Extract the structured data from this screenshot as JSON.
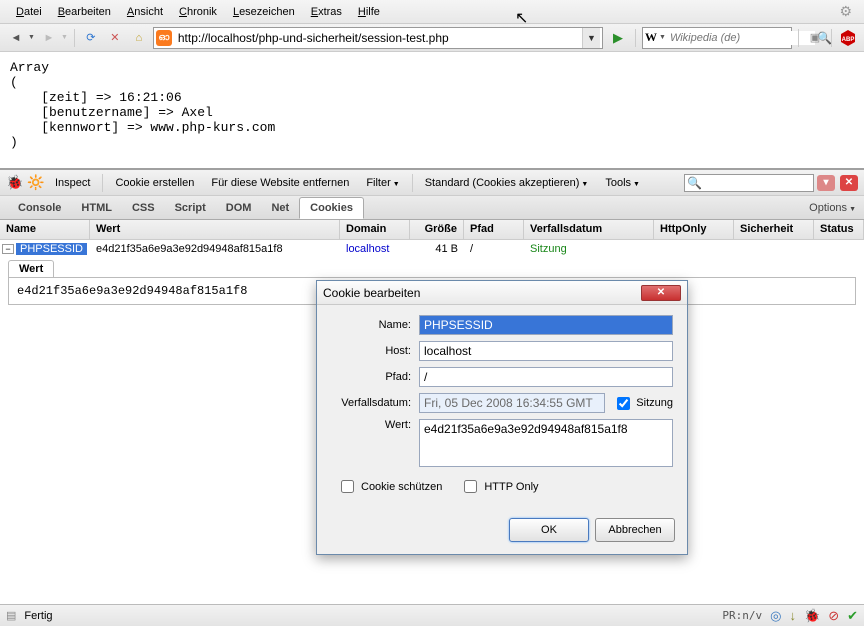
{
  "menubar": {
    "items": [
      {
        "label": "Datei",
        "accel": "D"
      },
      {
        "label": "Bearbeiten",
        "accel": "B"
      },
      {
        "label": "Ansicht",
        "accel": "A"
      },
      {
        "label": "Chronik",
        "accel": "C"
      },
      {
        "label": "Lesezeichen",
        "accel": "L"
      },
      {
        "label": "Extras",
        "accel": "E"
      },
      {
        "label": "Hilfe",
        "accel": "H"
      }
    ]
  },
  "toolbar": {
    "url": "http://localhost/php-und-sicherheit/session-test.php",
    "wiki_placeholder": "Wikipedia (de)",
    "wiki_prefix": "W"
  },
  "page": {
    "text": "Array\n(\n    [zeit] => 16:21:06\n    [benutzername] => Axel\n    [kennwort] => www.php-kurs.com\n)"
  },
  "firebug": {
    "toolbar": {
      "inspect": "Inspect",
      "create": "Cookie erstellen",
      "clear_site": "Für diese Website entfernen",
      "filter": "Filter",
      "permissions": "Standard (Cookies akzeptieren)",
      "tools": "Tools"
    },
    "tabs": {
      "console": "Console",
      "html": "HTML",
      "css": "CSS",
      "script": "Script",
      "dom": "DOM",
      "net": "Net",
      "cookies": "Cookies",
      "options": "Options"
    },
    "columns": {
      "name": "Name",
      "wert": "Wert",
      "domain": "Domain",
      "size": "Größe",
      "path": "Pfad",
      "expires": "Verfallsdatum",
      "httponly": "HttpOnly",
      "security": "Sicherheit",
      "status": "Status"
    },
    "row": {
      "name": "PHPSESSID",
      "wert": "e4d21f35a6e9a3e92d94948af815a1f8",
      "domain": "localhost",
      "size": "41 B",
      "path": "/",
      "expires": "Sitzung"
    },
    "wert_panel": {
      "tab": "Wert",
      "value": "e4d21f35a6e9a3e92d94948af815a1f8"
    }
  },
  "dialog": {
    "title": "Cookie bearbeiten",
    "labels": {
      "name": "Name:",
      "host": "Host:",
      "path": "Pfad:",
      "expires": "Verfallsdatum:",
      "wert": "Wert:",
      "session": "Sitzung",
      "protect": "Cookie schützen",
      "httponly": "HTTP Only",
      "ok": "OK",
      "cancel": "Abbrechen"
    },
    "values": {
      "name": "PHPSESSID",
      "host": "localhost",
      "path": "/",
      "expires": "Fri, 05 Dec 2008 16:34:55 GMT",
      "wert": "e4d21f35a6e9a3e92d94948af815a1f8",
      "session_checked": true,
      "protect_checked": false,
      "httponly_checked": false
    }
  },
  "statusbar": {
    "status": "Fertig",
    "prn": "PR:n/v"
  }
}
